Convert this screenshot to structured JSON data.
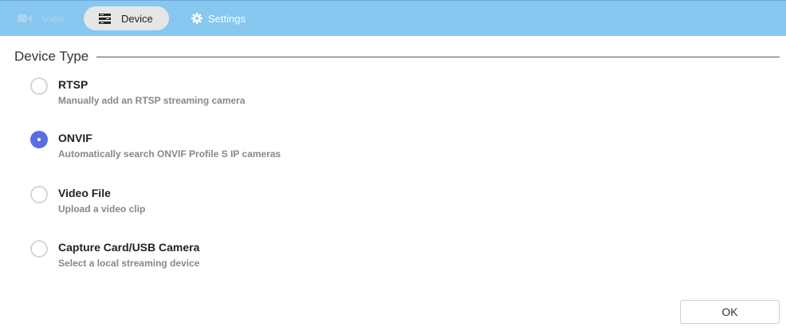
{
  "tabs": {
    "view": {
      "label": "View",
      "icon": "video-camera-icon"
    },
    "device": {
      "label": "Device",
      "icon": "list-icon",
      "active": true
    },
    "settings": {
      "label": "Settings",
      "icon": "gear-icon"
    }
  },
  "section": {
    "title": "Device Type"
  },
  "device_type_options": [
    {
      "label": "RTSP",
      "description": "Manually add an RTSP streaming camera",
      "selected": false
    },
    {
      "label": "ONVIF",
      "description": "Automatically search ONVIF Profile S IP cameras",
      "selected": true
    },
    {
      "label": "Video File",
      "description": "Upload a video clip",
      "selected": false
    },
    {
      "label": "Capture Card/USB Camera",
      "description": "Select a local streaming device",
      "selected": false
    }
  ],
  "footer": {
    "ok_label": "OK"
  },
  "colors": {
    "topbar": "#87c7f0",
    "accent": "#5b6ee0",
    "active_tab": "#e6e6e6"
  }
}
